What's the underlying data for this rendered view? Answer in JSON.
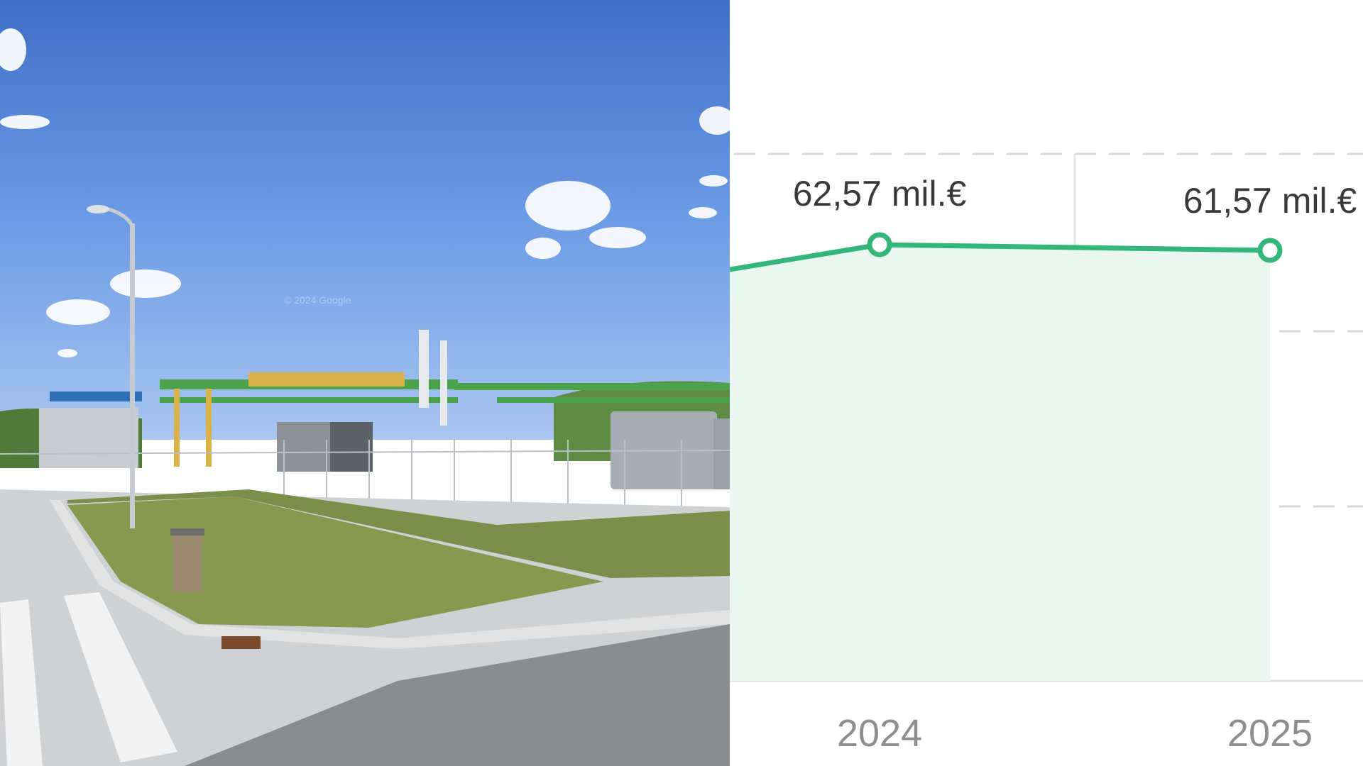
{
  "photo": {
    "watermark": "© 2024 Google",
    "subject": "industrial plant with pipe racks, tanks, fence, street lamp and sidewalk"
  },
  "colors": {
    "line": "#33b679",
    "area": "#eaf7f1",
    "gridline": "#d9d9d9",
    "sky": "#6c9be6"
  },
  "chart_data": {
    "type": "area",
    "categories": [
      "2024",
      "2025"
    ],
    "values": [
      62.57,
      61.57
    ],
    "value_labels": [
      "62,57 mil.€",
      "61,57 mil.€"
    ],
    "grid": true,
    "xlabel": "",
    "ylabel": ""
  }
}
